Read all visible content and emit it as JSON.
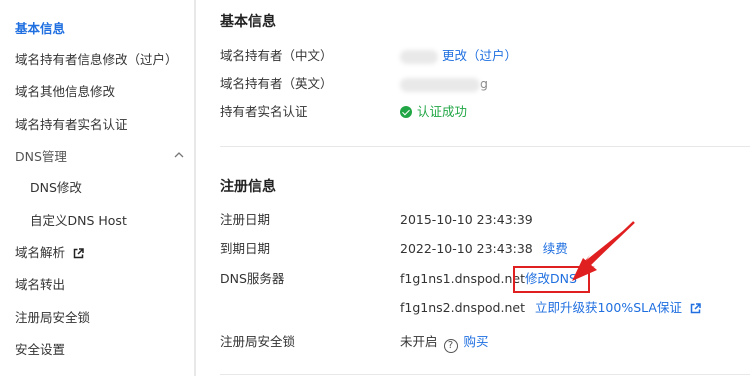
{
  "sidebar": {
    "items": [
      {
        "label": "基本信息"
      },
      {
        "label": "域名持有者信息修改（过户）"
      },
      {
        "label": "域名其他信息修改"
      },
      {
        "label": "域名持有者实名认证"
      },
      {
        "label": "DNS管理"
      },
      {
        "label": "DNS修改"
      },
      {
        "label": "自定义DNS Host"
      },
      {
        "label": "域名解析"
      },
      {
        "label": "域名转出"
      },
      {
        "label": "注册局安全锁"
      },
      {
        "label": "安全设置"
      }
    ]
  },
  "basic": {
    "title": "基本信息",
    "holder_cn_label": "域名持有者（中文）",
    "holder_cn_action": "更改（过户）",
    "holder_en_label": "域名持有者（英文）",
    "holder_en_tail": "g",
    "realname_label": "持有者实名认证",
    "realname_status": "认证成功"
  },
  "registration": {
    "title": "注册信息",
    "reg_date_label": "注册日期",
    "reg_date": "2015-10-10 23:43:39",
    "exp_date_label": "到期日期",
    "exp_date": "2022-10-10 23:43:38",
    "renew": "续费",
    "dns_label": "DNS服务器",
    "dns1": "f1g1ns1.dnspod.net",
    "dns_modify": "修改DNS",
    "dns2": "f1g1ns2.dnspod.net",
    "upgrade": "立即升级获100%SLA保证",
    "lock_label": "注册局安全锁",
    "lock_status": "未开启",
    "buy": "购买"
  },
  "colors": {
    "accent": "#1f6fe0",
    "success": "#21a645",
    "highlight": "#e02020"
  },
  "icons": [
    "external-link-icon",
    "chevron-up-icon",
    "check-circle-icon",
    "help-circle-icon",
    "annotation-arrow"
  ]
}
